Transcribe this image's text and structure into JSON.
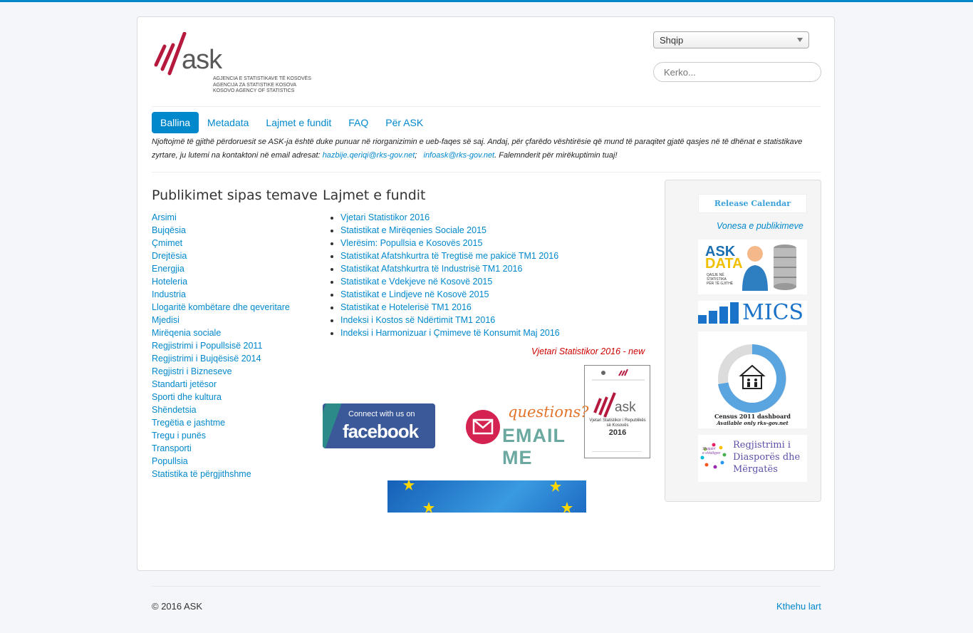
{
  "logo": {
    "text": "ask",
    "lines": [
      "AGJENCIA E STATISTIKAVE TË KOSOVËS",
      "AGENCIJA ZA STATISTIKE KOSOVA",
      "KOSOVO AGENCY OF STATISTICS"
    ]
  },
  "language": {
    "selected": "Shqip"
  },
  "search": {
    "placeholder": "Kerko..."
  },
  "nav": [
    "Ballina",
    "Metadata",
    "Lajmet e fundit",
    "FAQ",
    "Për ASK"
  ],
  "notice": {
    "text1": "Njoftojmë të gjithë përdoruesit se ASK-ja është duke punuar në riorganizimin e ueb-faqes së saj. Andaj, për çfarëdo vështirësie që mund të paraqitet gjatë qasjes në të dhënat e statistikave zyrtare, ju lutemi na kontaktoni në email adresat:",
    "email1": "hazbije.qeriqi@rks-gov.net",
    "sep": ";",
    "email2": "infoask@rks-gov.net",
    "text2": ". Falemnderit për mirëkuptimin tuaj!"
  },
  "topics": {
    "title": "Publikimet sipas temave",
    "items": [
      "Arsimi",
      "Bujqësia",
      "Çmimet",
      "Drejtësia",
      "Energjia",
      "Hoteleria",
      "Industria",
      "Llogaritë kombëtare dhe qeveritare",
      "Mjedisi",
      "Mirëqenia sociale",
      "Regjistrimi i Popullsisë 2011",
      "Regjistrimi i Bujqësisë 2014",
      "Regjistri i Bizneseve",
      "Standarti jetësor",
      "Sporti dhe kultura",
      "Shëndetsia",
      "Tregëtia e jashtme",
      "Tregu i punës",
      "Transporti",
      "Popullsia",
      "Statistika të përgjithshme"
    ]
  },
  "news": {
    "title": "Lajmet e fundit",
    "items": [
      "Vjetari Statistikor 2016",
      "Statistikat e Mirëqenies Sociale 2015",
      "Vlerësim: Popullsia e Kosovës 2015",
      "Statistikat Afatshkurtra të Tregtisë me pakicë TM1 2016",
      "Statistikat Afatshkurtra të Industrisë TM1 2016",
      "Statistikat e Vdekjeve në Kosovë 2015",
      "Statistikat e Lindjeve në Kosovë 2015",
      "Statistikat e Hotelerisë TM1 2016",
      "Indeksi i Kostos së Ndërtimit TM1 2016",
      "Indeksi i Harmonizuar i Çmimeve të Konsumit Maj 2016"
    ]
  },
  "yearbook": {
    "link": "Vjetari Statistikor 2016 - new",
    "cover_title": "Vjetari Statistikor i Republikës së Kosovës",
    "cover_year": "2016"
  },
  "facebook": {
    "line1": "Connect with us on",
    "line2": "facebook"
  },
  "email_banner": {
    "line1": "questions?",
    "line2": "EMAIL ME"
  },
  "sidebar": {
    "release_calendar": "Release Calendar",
    "vonesa": "Vonesa e publikimeve",
    "askdata": {
      "title1": "ASK",
      "title2": "DATA",
      "sub": [
        "QASJE NË",
        "STATISTIKA",
        "PËR TË GJITHË"
      ]
    },
    "mics": "MICS",
    "census": {
      "title": "Census 2011 dashboard",
      "sub": "Available only rks-gov.net"
    },
    "diaspora": [
      "Regjistrimi i",
      "Diasporës dhe",
      "Mërgatës"
    ],
    "diaspora_logo": [
      "Shqipëri",
      "e shkëlqyer"
    ]
  },
  "footer": {
    "copyright": "© 2016 ASK",
    "back_to_top": "Kthehu lart"
  },
  "colors": {
    "accent": "#0088cc",
    "logo_red": "#b5193d",
    "facebook": "#3b5998"
  }
}
